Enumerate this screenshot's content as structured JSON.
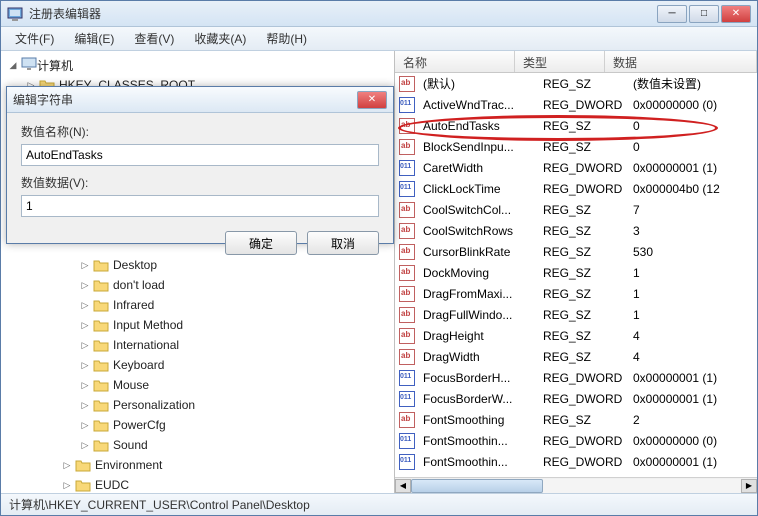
{
  "window": {
    "title": "注册表编辑器"
  },
  "menu": {
    "file": "文件(F)",
    "edit": "编辑(E)",
    "view": "查看(V)",
    "favorites": "收藏夹(A)",
    "help": "帮助(H)"
  },
  "tree": {
    "root": "计算机",
    "hkcr": "HKEY_CLASSES_ROOT",
    "items": [
      "Desktop",
      "don't load",
      "Infrared",
      "Input Method",
      "International",
      "Keyboard",
      "Mouse",
      "Personalization",
      "PowerCfg",
      "Sound"
    ],
    "after": [
      "Environment",
      "EUDC"
    ]
  },
  "columns": {
    "name": "名称",
    "type": "类型",
    "data": "数据"
  },
  "values": [
    {
      "icon": "str",
      "name": "(默认)",
      "type": "REG_SZ",
      "data": "(数值未设置)"
    },
    {
      "icon": "dw",
      "name": "ActiveWndTrac...",
      "type": "REG_DWORD",
      "data": "0x00000000 (0)"
    },
    {
      "icon": "str",
      "name": "AutoEndTasks",
      "type": "REG_SZ",
      "data": "0"
    },
    {
      "icon": "str",
      "name": "BlockSendInpu...",
      "type": "REG_SZ",
      "data": "0"
    },
    {
      "icon": "dw",
      "name": "CaretWidth",
      "type": "REG_DWORD",
      "data": "0x00000001 (1)"
    },
    {
      "icon": "dw",
      "name": "ClickLockTime",
      "type": "REG_DWORD",
      "data": "0x000004b0 (12"
    },
    {
      "icon": "str",
      "name": "CoolSwitchCol...",
      "type": "REG_SZ",
      "data": "7"
    },
    {
      "icon": "str",
      "name": "CoolSwitchRows",
      "type": "REG_SZ",
      "data": "3"
    },
    {
      "icon": "str",
      "name": "CursorBlinkRate",
      "type": "REG_SZ",
      "data": "530"
    },
    {
      "icon": "str",
      "name": "DockMoving",
      "type": "REG_SZ",
      "data": "1"
    },
    {
      "icon": "str",
      "name": "DragFromMaxi...",
      "type": "REG_SZ",
      "data": "1"
    },
    {
      "icon": "str",
      "name": "DragFullWindo...",
      "type": "REG_SZ",
      "data": "1"
    },
    {
      "icon": "str",
      "name": "DragHeight",
      "type": "REG_SZ",
      "data": "4"
    },
    {
      "icon": "str",
      "name": "DragWidth",
      "type": "REG_SZ",
      "data": "4"
    },
    {
      "icon": "dw",
      "name": "FocusBorderH...",
      "type": "REG_DWORD",
      "data": "0x00000001 (1)"
    },
    {
      "icon": "dw",
      "name": "FocusBorderW...",
      "type": "REG_DWORD",
      "data": "0x00000001 (1)"
    },
    {
      "icon": "str",
      "name": "FontSmoothing",
      "type": "REG_SZ",
      "data": "2"
    },
    {
      "icon": "dw",
      "name": "FontSmoothin...",
      "type": "REG_DWORD",
      "data": "0x00000000 (0)"
    },
    {
      "icon": "dw",
      "name": "FontSmoothin...",
      "type": "REG_DWORD",
      "data": "0x00000001 (1)"
    }
  ],
  "dialog": {
    "title": "编辑字符串",
    "name_label": "数值名称(N):",
    "name_value": "AutoEndTasks",
    "data_label": "数值数据(V):",
    "data_value": "1",
    "ok": "确定",
    "cancel": "取消"
  },
  "statusbar": "计算机\\HKEY_CURRENT_USER\\Control Panel\\Desktop"
}
